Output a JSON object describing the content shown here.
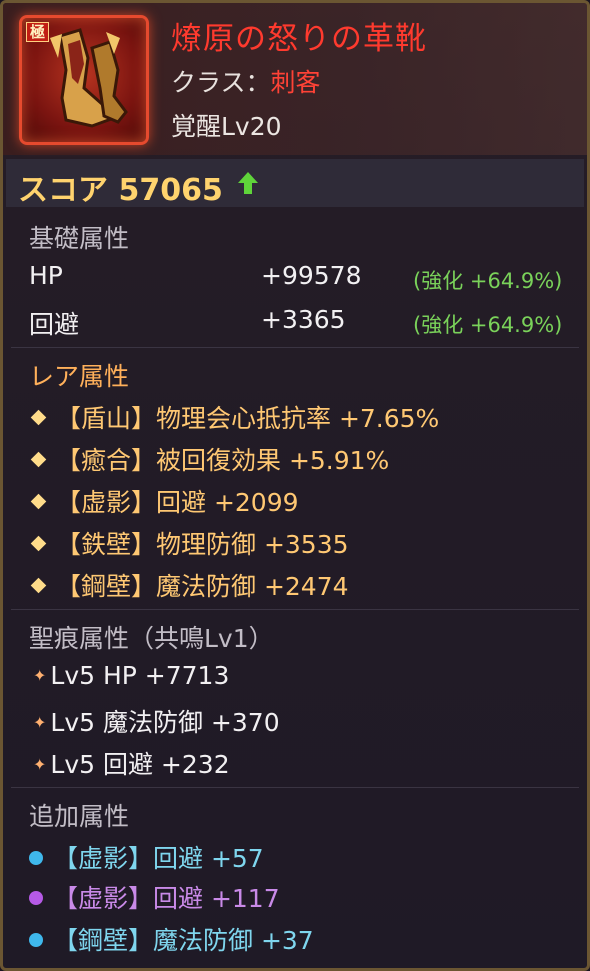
{
  "item": {
    "rank_badge": "極",
    "name": "燎原の怒りの革靴",
    "class_label": "クラス：",
    "class_value": "刺客",
    "awakening": "覚醒Lv20"
  },
  "score": {
    "text": "スコア 57065",
    "trend": "up-arrow-icon"
  },
  "base": {
    "title": "基礎属性",
    "rows": [
      {
        "name": "HP",
        "value": "+99578",
        "bonus": "(強化 +64.9%)"
      },
      {
        "name": "回避",
        "value": "+3365",
        "bonus": "(強化 +64.9%)"
      }
    ]
  },
  "rare": {
    "title": "レア属性",
    "rows": [
      "【盾山】物理会心抵抗率 +7.65%",
      "【癒合】被回復効果 +5.91%",
      "【虚影】回避 +2099",
      "【鉄壁】物理防御 +3535",
      "【鋼壁】魔法防御 +2474"
    ]
  },
  "seikon": {
    "title": "聖痕属性（共鳴Lv1）",
    "rows": [
      "Lv5 HP +7713",
      "Lv5 魔法防御 +370",
      "Lv5 回避 +232"
    ]
  },
  "extra": {
    "title": "追加属性",
    "rows": [
      {
        "text": "【虚影】回避 +57",
        "color": "#3fb8ec"
      },
      {
        "text": "【虚影】回避 +117",
        "color": "#b65ae6"
      },
      {
        "text": "【鋼壁】魔法防御 +37",
        "color": "#3fb8ec"
      }
    ]
  },
  "colors": {
    "item_name": "#ff3a2e",
    "score": "#ffd36e",
    "bonus_green": "#7ad25a",
    "rare_orange": "#ffc873"
  }
}
